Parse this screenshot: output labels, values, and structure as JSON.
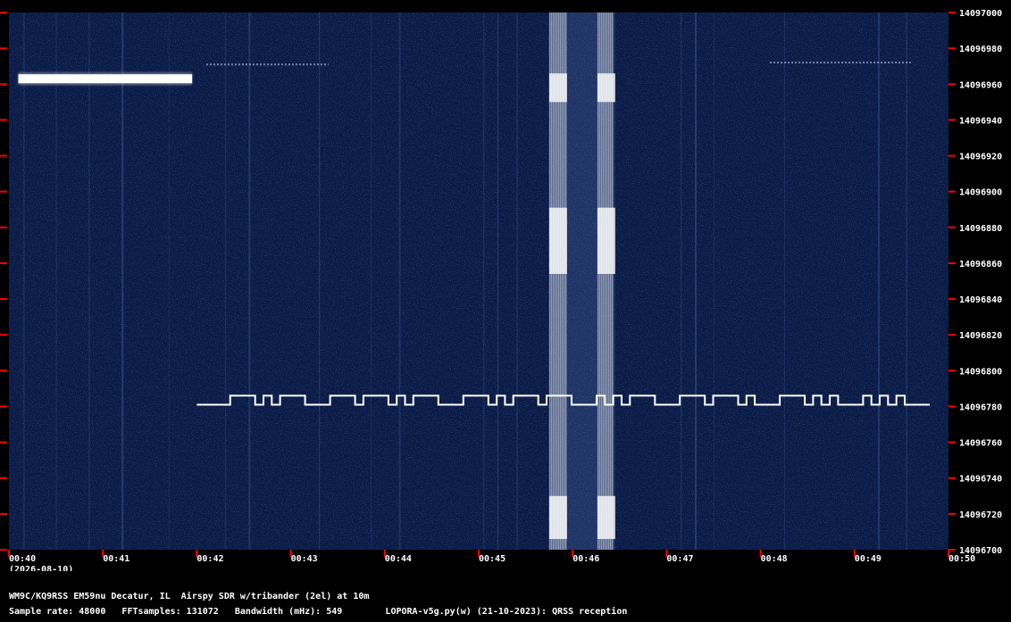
{
  "chart_data": {
    "type": "heatmap",
    "title": "",
    "xlabel": "",
    "ylabel": "",
    "x_ticks": [
      "00:40",
      "00:41",
      "00:42",
      "00:43",
      "00:44",
      "00:45",
      "00:46",
      "00:47",
      "00:48",
      "00:49",
      "00:50"
    ],
    "x_date": "(2026-08-10)",
    "y_ticks": [
      14097000,
      14096980,
      14096960,
      14096940,
      14096920,
      14096900,
      14096880,
      14096860,
      14096840,
      14096820,
      14096800,
      14096780,
      14096760,
      14096740,
      14096720,
      14096700
    ],
    "xlim_minutes": [
      0,
      10
    ],
    "ylim": [
      14096700,
      14097000
    ],
    "colors": {
      "background": "#0a1a44",
      "signal": "#ffffff",
      "tick": "#ff0000"
    },
    "signals": {
      "early_carrier": {
        "t0": 0.1,
        "t1": 1.95,
        "freq": 14096963
      },
      "faint_carrier": {
        "t0": 2.1,
        "t1": 3.4,
        "freq": 14096971
      },
      "late_faint_carrier": {
        "t0": 8.1,
        "t1": 9.6,
        "freq": 14096972
      },
      "qrss_fsk": {
        "t0": 2.0,
        "t1": 9.8,
        "freq_low": 14096781,
        "freq_high": 14096786,
        "pattern": [
          0,
          0,
          0,
          0,
          1,
          1,
          1,
          0,
          1,
          0,
          1,
          1,
          1,
          0,
          0,
          0,
          1,
          1,
          1,
          0,
          1,
          1,
          1,
          0,
          1,
          0,
          1,
          1,
          1,
          0,
          0,
          0,
          1,
          1,
          1,
          0,
          1,
          0,
          1,
          1,
          1,
          0,
          1,
          1,
          1,
          0,
          0,
          0,
          1,
          0,
          1,
          0,
          1,
          1,
          1,
          0,
          0,
          0,
          1,
          1,
          1,
          0,
          1,
          1,
          1,
          0,
          1,
          0,
          0,
          0,
          1,
          1,
          1,
          0,
          1,
          0,
          1,
          0,
          0,
          0,
          1,
          0,
          1,
          0,
          1,
          0,
          0,
          0
        ]
      },
      "qrm_burst": {
        "t0": 5.75,
        "t1": 6.45
      }
    }
  },
  "header": {
    "station": "WM9C/KQ9RSS EM59nu Decatur, IL  Airspy SDR w/tribander (2el) at 10m",
    "info": "Sample rate: 48000   FFTsamples: 131072   Bandwidth (mHz): 549        LOPORA-v5g.py(w) (21-10-2023): QRSS reception"
  }
}
